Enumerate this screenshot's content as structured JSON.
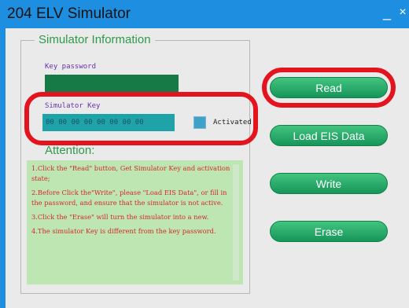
{
  "window": {
    "title": "204 ELV Simulator",
    "min_glyph": "_",
    "close_glyph": "×"
  },
  "group": {
    "legend": "Simulator Information",
    "key_password_label": "Key password",
    "key_password_value": "",
    "simulator_key_label": "Simulator Key",
    "simulator_key_value": "00 00 00 00 00 00 00 00",
    "activated_label": "Activated",
    "activated_checked": false,
    "attention": "Attention:",
    "notes": [
      "1.Click the \"Read\" button, Get Simulator Key and activation state;",
      "2.Before Click the\"Write\", please \"Load EIS Data\", or fill in the password, and ensure that the simulator is not active.",
      "3.Click the \"Erase\" will turn the simulator into a new.",
      "4.The simulator Key is different from the key password."
    ]
  },
  "buttons": {
    "read": "Read",
    "load": "Load EIS Data",
    "write": "Write",
    "erase": "Erase"
  },
  "colors": {
    "titlebar": "#1e8fe0",
    "accent_green": "#2e9a49",
    "highlight_red": "#e4141f",
    "button_green": "#17955a"
  }
}
